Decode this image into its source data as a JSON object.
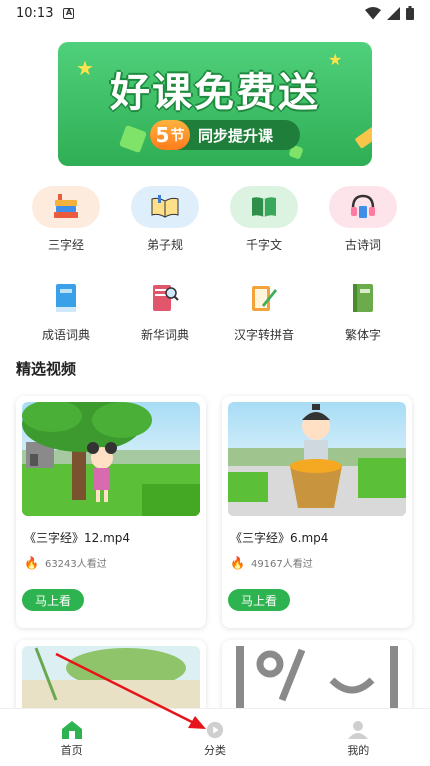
{
  "status_bar": {
    "time": "10:13",
    "notif_icon_letter": "A"
  },
  "banner": {
    "title": "好课免费送",
    "pill_number": "5",
    "pill_unit": "节",
    "pill_text": "同步提升课"
  },
  "categories": [
    {
      "label": "三字经",
      "icon": "books-stack-icon",
      "bg": "#fdecde"
    },
    {
      "label": "弟子规",
      "icon": "open-book-icon",
      "bg": "#dfeefb"
    },
    {
      "label": "千字文",
      "icon": "green-book-icon",
      "bg": "#dcf3e2"
    },
    {
      "label": "古诗词",
      "icon": "headphones-book-icon",
      "bg": "#fde4ea"
    },
    {
      "label": "成语词典",
      "icon": "blue-book-icon"
    },
    {
      "label": "新华词典",
      "icon": "book-magnifier-icon"
    },
    {
      "label": "汉字转拼音",
      "icon": "pencil-notebook-icon"
    },
    {
      "label": "繁体字",
      "icon": "green-dictionary-icon"
    }
  ],
  "section": {
    "title": "精选视频"
  },
  "videos": [
    {
      "title": "《三字经》12.mp4",
      "views": "63243人看过",
      "button": "马上看"
    },
    {
      "title": "《三字经》6.mp4",
      "views": "49167人看过",
      "button": "马上看"
    }
  ],
  "bottom_nav": [
    {
      "label": "首页",
      "icon": "home-icon",
      "active": true
    },
    {
      "label": "分类",
      "icon": "play-circle-icon",
      "active": false
    },
    {
      "label": "我的",
      "icon": "user-icon",
      "active": false
    }
  ],
  "colors": {
    "accent": "#2db34f",
    "banner": "#3cc163",
    "arrow": "#e8141b"
  }
}
